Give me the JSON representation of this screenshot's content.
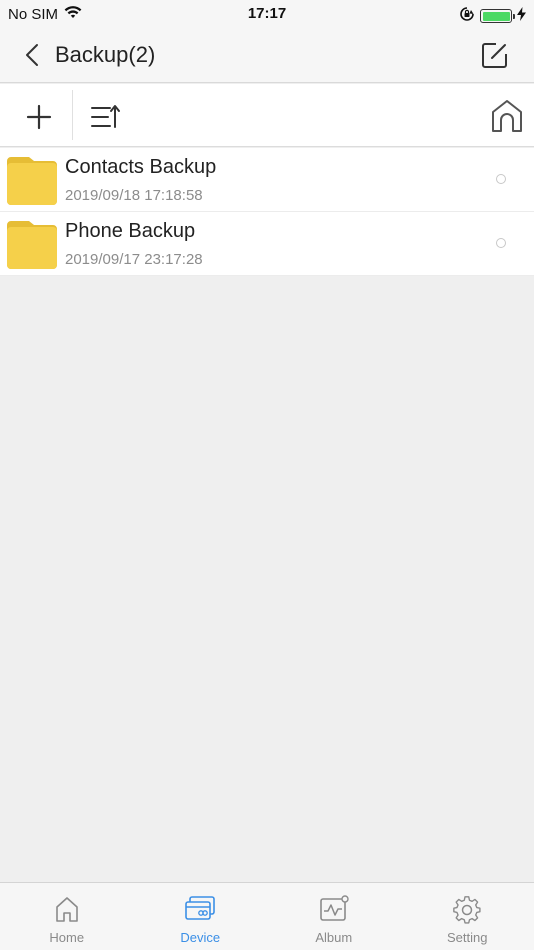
{
  "status_bar": {
    "carrier": "No SIM",
    "time": "17:17",
    "battery_level": 1.0
  },
  "nav": {
    "title": "Backup(2)",
    "back_icon": "chevron-left-icon",
    "edit_icon": "edit-icon"
  },
  "toolbar": {
    "add_icon": "plus-icon",
    "sort_icon": "sort-icon",
    "home_icon": "home-outline-icon"
  },
  "files": [
    {
      "name": "Contacts Backup",
      "date": "2019/09/18 17:18:58",
      "icon": "folder-icon"
    },
    {
      "name": "Phone Backup",
      "date": "2019/09/17 23:17:28",
      "icon": "folder-icon"
    }
  ],
  "tabs": [
    {
      "label": "Home",
      "icon": "home-icon",
      "active": false
    },
    {
      "label": "Device",
      "icon": "device-icon",
      "active": true
    },
    {
      "label": "Album",
      "icon": "album-icon",
      "active": false
    },
    {
      "label": "Setting",
      "icon": "gear-icon",
      "active": false
    }
  ],
  "colors": {
    "accent": "#3b8fe6",
    "folder": "#f5d04a",
    "battery": "#4cd964"
  }
}
